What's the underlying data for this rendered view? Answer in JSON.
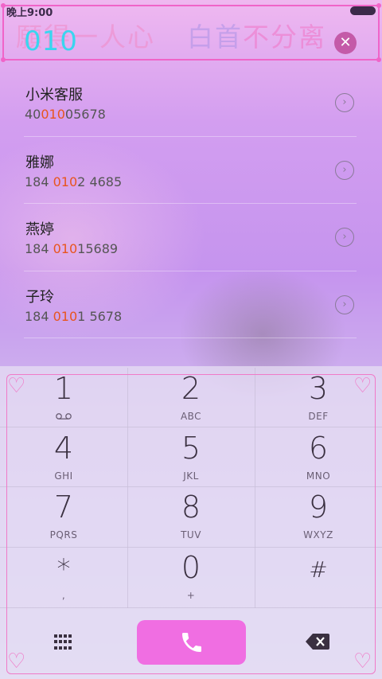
{
  "status_bar": {
    "time": "晚上9:00"
  },
  "header": {
    "art_text_1": "願得一人心",
    "art_text_2": "白首",
    "art_text_3": "不分离",
    "dialed_number": "010",
    "clear_icon": "✕"
  },
  "contacts": [
    {
      "name": "小米客服",
      "number_pre": "40",
      "number_hl": "010",
      "number_post": "05678"
    },
    {
      "name": "雅娜",
      "number_pre": "184 ",
      "number_hl": "010",
      "number_post": "2 4685"
    },
    {
      "name": "燕婷",
      "number_pre": "184 ",
      "number_hl": "010",
      "number_post": "15689"
    },
    {
      "name": "子玲",
      "number_pre": "184 ",
      "number_hl": "010",
      "number_post": "1 5678"
    }
  ],
  "detail_icon": "›",
  "keypad": {
    "keys": [
      {
        "digit": "1",
        "letters": ""
      },
      {
        "digit": "2",
        "letters": "ABC"
      },
      {
        "digit": "3",
        "letters": "DEF"
      },
      {
        "digit": "4",
        "letters": "GHI"
      },
      {
        "digit": "5",
        "letters": "JKL"
      },
      {
        "digit": "6",
        "letters": "MNO"
      },
      {
        "digit": "7",
        "letters": "PQRS"
      },
      {
        "digit": "8",
        "letters": "TUV"
      },
      {
        "digit": "9",
        "letters": "WXYZ"
      },
      {
        "digit": "*",
        "letters": ","
      },
      {
        "digit": "0",
        "letters": "+"
      },
      {
        "digit": "#",
        "letters": ""
      }
    ]
  },
  "icons": {
    "voicemail": "voicemail-icon",
    "keypad_toggle": "keypad-grid-icon",
    "call": "phone-icon",
    "backspace": "backspace-icon",
    "heart": "♡"
  },
  "colors": {
    "accent_pink": "#f06ee2",
    "frame_pink": "#f064c8",
    "dialed_cyan": "#3ad5ef",
    "highlight_orange": "#e8551e"
  }
}
